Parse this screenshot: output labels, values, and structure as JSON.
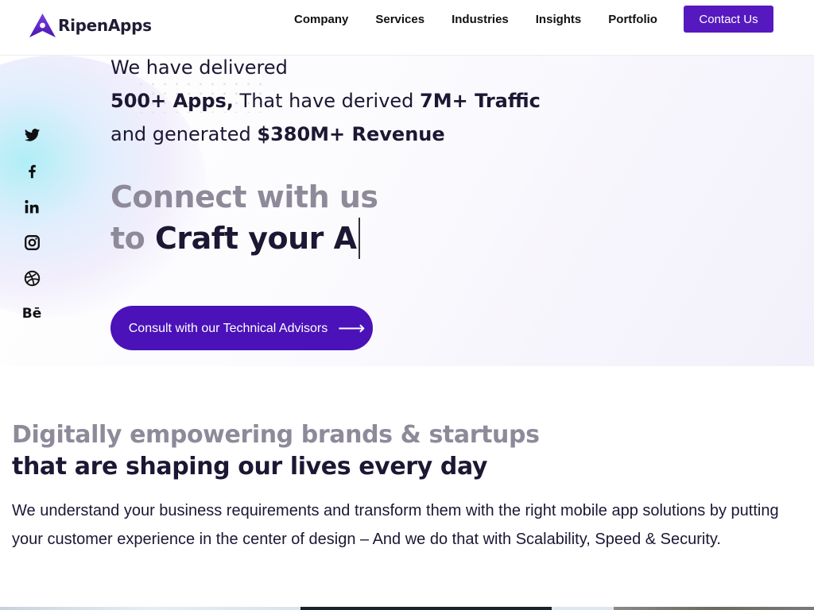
{
  "header": {
    "brand": "RipenApps",
    "nav": [
      "Company",
      "Services",
      "Industries",
      "Insights",
      "Portfolio"
    ],
    "contact_label": "Contact Us"
  },
  "colors": {
    "accent": "#5619bf",
    "cta": "#4a12b8",
    "text_dark": "#1c1733",
    "text_muted": "#8e8a9a"
  },
  "social": [
    {
      "name": "twitter",
      "icon": "twitter-icon"
    },
    {
      "name": "facebook",
      "icon": "facebook-icon"
    },
    {
      "name": "linkedin",
      "icon": "linkedin-icon"
    },
    {
      "name": "instagram",
      "icon": "instagram-icon"
    },
    {
      "name": "dribbble",
      "icon": "dribbble-icon"
    },
    {
      "name": "behance",
      "icon": "behance-icon",
      "glyph": "Bē"
    }
  ],
  "hero": {
    "line1": "We have delivered",
    "apps": "500+ Apps,",
    "mid": " That have derived ",
    "traffic": "7M+ Traffic",
    "line3_prefix": "and generated ",
    "revenue": "$380M+ Revenue",
    "connect_line1": "Connect with us",
    "connect_to": "to ",
    "connect_typed": "Craft your A",
    "cta_label": "Consult with our Technical Advisors",
    "cta_arrow": "⟶"
  },
  "section2": {
    "title_muted": "Digitally empowering brands & startups",
    "title_dark": "that are shaping our lives every day",
    "body": "We understand your business requirements and transform them with the right mobile app solutions by putting your customer experience in the center of design – And we do that with Scalability, Speed & Security."
  }
}
